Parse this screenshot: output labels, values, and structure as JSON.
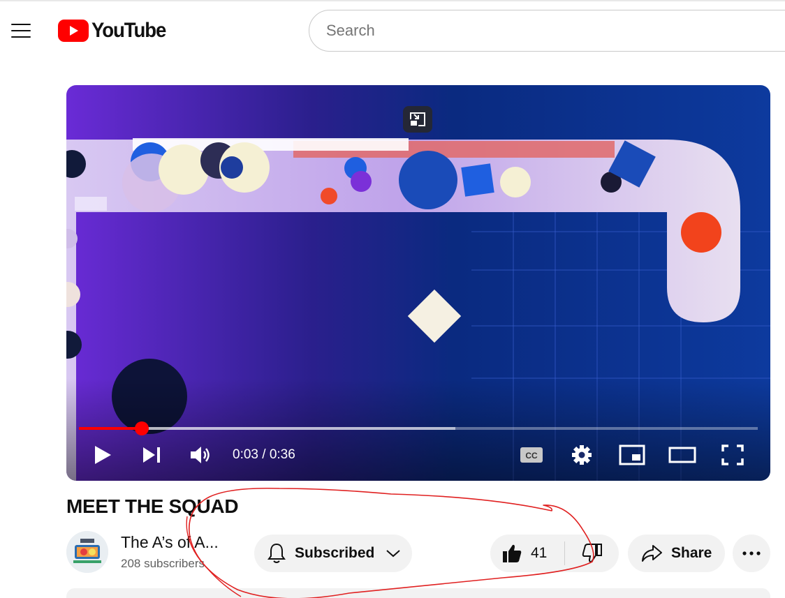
{
  "header": {
    "logo_text": "YouTube",
    "search_placeholder": "Search"
  },
  "player": {
    "current_time": "0:03",
    "duration": "0:36",
    "time_display": "0:03 / 0:36",
    "played_fraction": 0.093,
    "buffered_fraction": 0.555,
    "accent_color": "#ff0000"
  },
  "video": {
    "title": "MEET THE SQUAD",
    "channel_name": "The A’s of A...",
    "subscribers": "208 subscribers"
  },
  "actions": {
    "subscribe_label": "Subscribed",
    "like_count": "41",
    "share_label": "Share"
  },
  "icons": [
    "menu-icon",
    "youtube-logo-icon",
    "miniplayer-exit-icon",
    "play-icon",
    "next-icon",
    "volume-icon",
    "captions-icon",
    "settings-icon",
    "miniplayer-icon",
    "theater-icon",
    "fullscreen-icon",
    "bell-icon",
    "chevron-down-icon",
    "like-icon",
    "dislike-icon",
    "share-icon",
    "more-icon"
  ],
  "annotation_color": "#e02020"
}
